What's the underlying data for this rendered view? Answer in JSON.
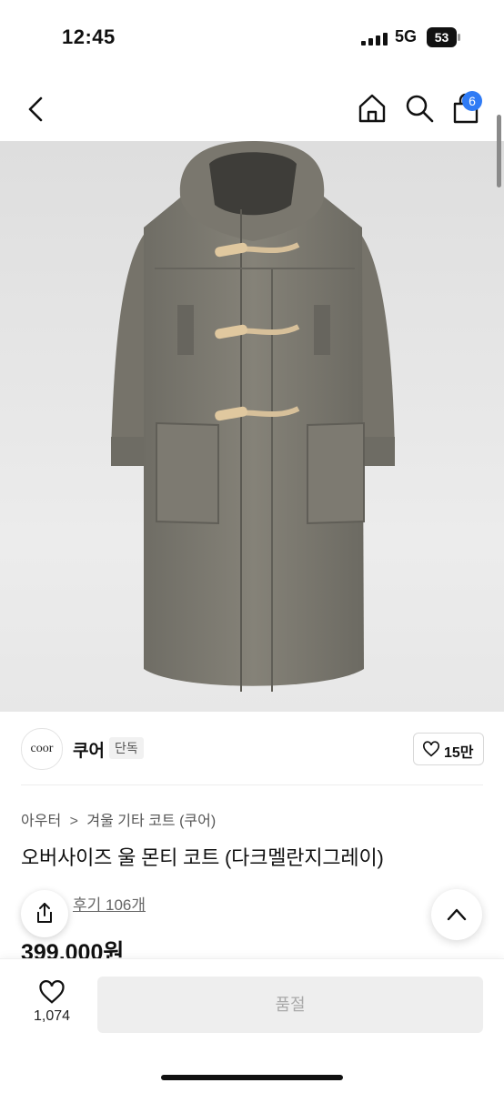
{
  "status_bar": {
    "time": "12:45",
    "network": "5G",
    "battery": "53"
  },
  "header": {
    "cart_count": "6"
  },
  "brand": {
    "logo_text": "coor",
    "name": "쿠어",
    "badge": "단독",
    "likes": "15만"
  },
  "breadcrumb": [
    "아우터",
    "겨울 기타 코트 (쿠어)"
  ],
  "breadcrumb_separator": ">",
  "product": {
    "title": "오버사이즈 울 몬티 코트 (다크멜란지그레이)",
    "reviews": "후기 106개",
    "price": "399,000원"
  },
  "bottom_bar": {
    "wish_count": "1,074",
    "buy_label": "품절"
  },
  "colors": {
    "accent_badge": "#2f7bf5",
    "soldout_bg": "#eeeeee",
    "coat": "#7d7a70"
  },
  "icons": [
    "back-icon",
    "home-icon",
    "search-icon",
    "cart-icon",
    "heart-icon",
    "share-icon",
    "chevron-up-icon"
  ]
}
